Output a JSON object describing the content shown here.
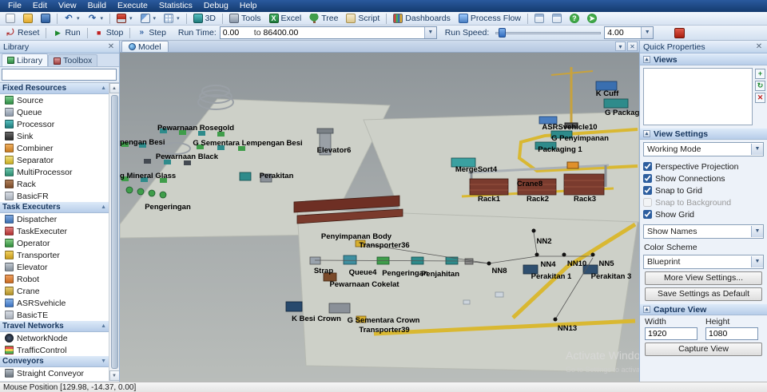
{
  "menu": {
    "items": [
      "File",
      "Edit",
      "View",
      "Build",
      "Execute",
      "Statistics",
      "Debug",
      "Help"
    ]
  },
  "toolbar": {
    "three_d": "3D",
    "tools": "Tools",
    "excel": "Excel",
    "tree": "Tree",
    "script": "Script",
    "dashboards": "Dashboards",
    "process_flow": "Process Flow"
  },
  "exec": {
    "reset": "Reset",
    "run": "Run",
    "stop": "Stop",
    "step": "Step",
    "run_time_label": "Run Time:",
    "run_time_from": "0.00",
    "to_label": "to",
    "run_time_to": "86400.00",
    "run_speed_label": "Run Speed:",
    "run_speed_value": "4.00"
  },
  "library": {
    "title": "Library",
    "tabs": [
      {
        "label": "Library"
      },
      {
        "label": "Toolbox"
      }
    ],
    "search_value": "",
    "sections": [
      {
        "label": "Fixed Resources",
        "items": [
          "Source",
          "Queue",
          "Processor",
          "Sink",
          "Combiner",
          "Separator",
          "MultiProcessor",
          "Rack",
          "BasicFR"
        ]
      },
      {
        "label": "Task Executers",
        "items": [
          "Dispatcher",
          "TaskExecuter",
          "Operator",
          "Transporter",
          "Elevator",
          "Robot",
          "Crane",
          "ASRSvehicle",
          "BasicTE"
        ]
      },
      {
        "label": "Travel Networks",
        "items": [
          "NetworkNode",
          "TrafficControl"
        ]
      },
      {
        "label": "Conveyors",
        "items": [
          "Straight Conveyor"
        ]
      }
    ]
  },
  "model_tab": {
    "label": "Model"
  },
  "scene": {
    "labels": [
      "Pewarnaan Rosegold",
      "pengan Besi",
      "G Sementara Lempengan Besi",
      "Pewarnaan Black",
      "Elevator6",
      "K Cuff",
      "G Packaging",
      "ASRSvehicle10",
      "G Penyimpanan",
      "Packaging 1",
      "MergeSort4",
      "g Mineral Glass",
      "Perakitan",
      "Crane8",
      "Rack1",
      "Rack2",
      "Rack3",
      "Pengeringan",
      "Penyimpanan Body",
      "Transporter36",
      "NN2",
      "Strap",
      "Queue4",
      "Pengeringan",
      "Penjahitan",
      "NN8",
      "NN4",
      "NN10",
      "NN5",
      "Perakitan 1",
      "Perakitan 3",
      "Pewarnaan Cokelat",
      "K Besi Crown",
      "G Sementara Crown",
      "Transporter39",
      "NN13"
    ],
    "watermark": {
      "line1": "Activate Windows",
      "line2": "Go to Settings to activate Windows."
    }
  },
  "qp": {
    "title": "Quick Properties",
    "views_title": "Views",
    "view_settings_title": "View Settings",
    "capture_title": "Capture View",
    "working_mode": "Working Mode",
    "checkboxes": [
      {
        "label": "Perspective Projection",
        "checked": true
      },
      {
        "label": "Show Connections",
        "checked": true
      },
      {
        "label": "Snap to Grid",
        "checked": true
      },
      {
        "label": "Snap to Background",
        "checked": false
      },
      {
        "label": "Show Grid",
        "checked": true
      }
    ],
    "show_names": "Show Names",
    "color_scheme_label": "Color Scheme",
    "color_scheme": "Blueprint",
    "more_view_settings": "More View Settings...",
    "save_defaults": "Save Settings as Default",
    "width_label": "Width",
    "width": "1920",
    "height_label": "Height",
    "height": "1080",
    "capture_button": "Capture View"
  },
  "status": {
    "text": "Mouse Position [129.98, -14.37, 0.00]"
  }
}
